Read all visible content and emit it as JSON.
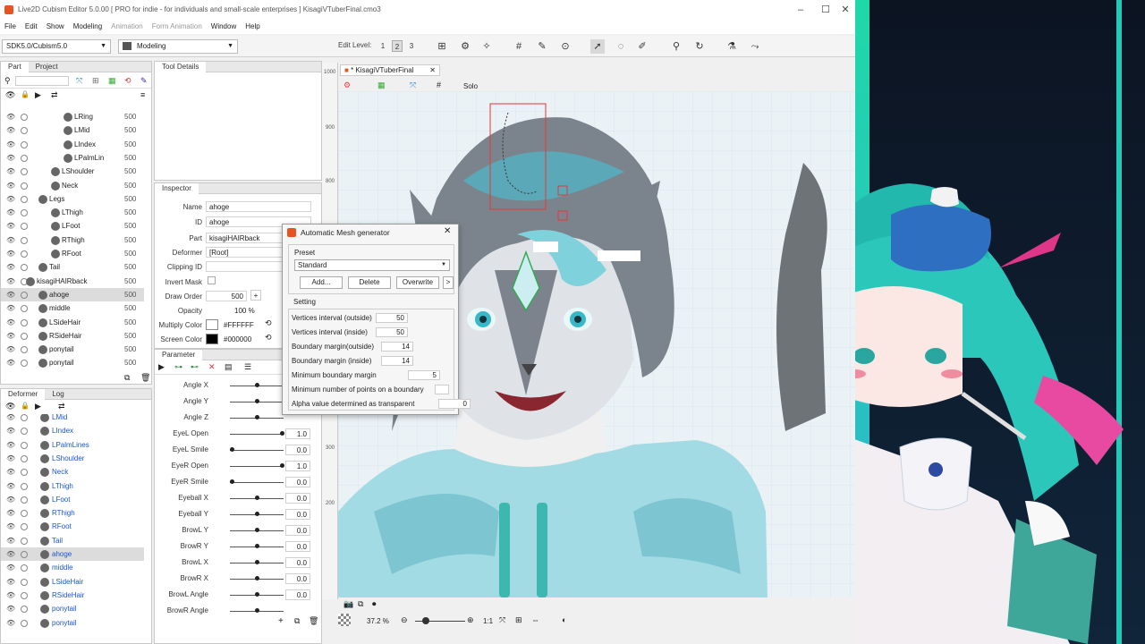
{
  "window": {
    "title": "Live2D Cubism Editor 5.0.00   [ PRO for indie - for individuals and small-scale enterprises ]   KisagiVTuberFinal.cmo3",
    "min": "–",
    "max": "☐",
    "close": "✕"
  },
  "menu": [
    "File",
    "Edit",
    "Show",
    "Modeling",
    "Animation",
    "Form Animation",
    "Window",
    "Help"
  ],
  "toolbar": {
    "sdk": "SDK5.0/Cubism5.0",
    "mode": "Modeling",
    "edit_level_label": "Edit Level:",
    "levels": [
      "1",
      "2",
      "3"
    ]
  },
  "part_panel": {
    "tabs": [
      "Part",
      "Project"
    ],
    "rows": [
      {
        "name": "LRing",
        "value": "500",
        "indent": 2
      },
      {
        "name": "LMid",
        "value": "500",
        "indent": 2
      },
      {
        "name": "LIndex",
        "value": "500",
        "indent": 2
      },
      {
        "name": "LPalmLin",
        "value": "500",
        "indent": 2
      },
      {
        "name": "LShoulder",
        "value": "500",
        "indent": 1
      },
      {
        "name": "Neck",
        "value": "500",
        "indent": 1
      },
      {
        "name": "Legs",
        "value": "500",
        "indent": 0
      },
      {
        "name": "LThigh",
        "value": "500",
        "indent": 1
      },
      {
        "name": "LFoot",
        "value": "500",
        "indent": 1
      },
      {
        "name": "RThigh",
        "value": "500",
        "indent": 1
      },
      {
        "name": "RFoot",
        "value": "500",
        "indent": 1
      },
      {
        "name": "Tail",
        "value": "500",
        "indent": 0
      },
      {
        "name": "kisagiHAIRback",
        "value": "500",
        "indent": -1
      },
      {
        "name": "ahoge",
        "value": "500",
        "indent": 0
      },
      {
        "name": "middle",
        "value": "500",
        "indent": 0
      },
      {
        "name": "LSideHair",
        "value": "500",
        "indent": 0
      },
      {
        "name": "RSideHair",
        "value": "500",
        "indent": 0
      },
      {
        "name": "ponytail",
        "value": "500",
        "indent": 0
      },
      {
        "name": "ponytail",
        "value": "500",
        "indent": 0
      }
    ]
  },
  "tool_details": {
    "title": "Tool Details"
  },
  "inspector": {
    "title": "Inspector",
    "name_label": "Name",
    "name": "ahoge",
    "id_label": "ID",
    "id": "ahoge",
    "part_label": "Part",
    "part": "kisagiHAIRback",
    "deformer_label": "Deformer",
    "deformer": "[Root]",
    "clipping_label": "Clipping ID",
    "invert_label": "Invert Mask",
    "draw_order_label": "Draw Order",
    "draw_order": "500",
    "opacity_label": "Opacity",
    "opacity": "100 %",
    "multiply_label": "Multiply Color",
    "multiply": "#FFFFFF",
    "screen_label": "Screen Color",
    "screen": "#000000"
  },
  "parameter": {
    "title": "Parameter",
    "rows": [
      {
        "name": "Angle X",
        "value": "",
        "level": 0.5
      },
      {
        "name": "Angle Y",
        "value": "",
        "level": 0.5
      },
      {
        "name": "Angle Z",
        "value": "",
        "level": 0.5
      },
      {
        "name": "EyeL Open",
        "value": "1.0",
        "level": 1
      },
      {
        "name": "EyeL Smile",
        "value": "0.0",
        "level": 0
      },
      {
        "name": "EyeR Open",
        "value": "1.0",
        "level": 1
      },
      {
        "name": "EyeR Smile",
        "value": "0.0",
        "level": 0
      },
      {
        "name": "Eyeball X",
        "value": "0.0",
        "level": 0.5
      },
      {
        "name": "Eyeball Y",
        "value": "0.0",
        "level": 0.5
      },
      {
        "name": "BrowL Y",
        "value": "0.0",
        "level": 0.5
      },
      {
        "name": "BrowR Y",
        "value": "0.0",
        "level": 0.5
      },
      {
        "name": "BrowL X",
        "value": "0.0",
        "level": 0.5
      },
      {
        "name": "BrowR X",
        "value": "0.0",
        "level": 0.5
      },
      {
        "name": "BrowL Angle",
        "value": "0.0",
        "level": 0.5
      },
      {
        "name": "BrowR Angle",
        "value": "",
        "level": 0.5
      }
    ]
  },
  "deformer_panel": {
    "tabs": [
      "Deformer",
      "Log"
    ],
    "rows": [
      "LMid",
      "LIndex",
      "LPalmLines",
      "LShoulder",
      "Neck",
      "LThigh",
      "LFoot",
      "RThigh",
      "RFoot",
      "Tail",
      "ahoge",
      "middle",
      "LSideHair",
      "RSideHair",
      "ponytail",
      "ponytail"
    ]
  },
  "canvas": {
    "tab": "* KisagiVTuberFinal",
    "solo": "Solo",
    "zoom": "37.2 %",
    "ratio": "1:1",
    "ruler": [
      "1000",
      "900",
      "800",
      "300",
      "200"
    ]
  },
  "dialog": {
    "title": "Automatic Mesh generator",
    "preset_label": "Preset",
    "preset": "Standard",
    "add": "Add...",
    "delete": "Delete",
    "overwrite": "Overwrite",
    "more": ">",
    "setting_label": "Setting",
    "settings": [
      {
        "label": "Vertices interval (outside)",
        "value": "50"
      },
      {
        "label": "Vertices interval (inside)",
        "value": "50"
      },
      {
        "label": "Boundary margin(outside)",
        "value": "14"
      },
      {
        "label": "Boundary margin (inside)",
        "value": "14"
      },
      {
        "label": "Minimum boundary margin",
        "value": "5"
      },
      {
        "label": "Minimum number of points on a boundary",
        "value": ""
      },
      {
        "label": "Alpha value determined as transparent",
        "value": "0"
      }
    ]
  }
}
